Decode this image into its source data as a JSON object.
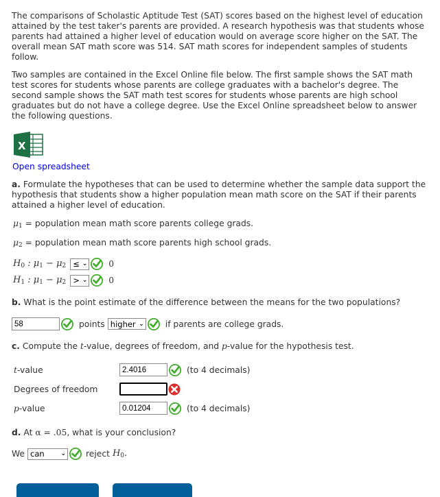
{
  "intro": {
    "paragraph1": "The comparisons of Scholastic Aptitude Test (SAT) scores based on the highest level of education attained by the test taker's parents are provided. A research hypothesis was that students whose parents had attained a higher level of education would on average score higher on the SAT. The overall mean SAT math score was 514. SAT math scores for independent samples of students follow.",
    "paragraph2": "Two samples are contained in the Excel Online file below. The first sample shows the SAT math test scores for students whose parents are college graduates with a bachelor's degree. The second sample shows the SAT math test scores for students whose parents are high school graduates but do not have a college degree. Use the Excel Online spreadsheet below to answer the following questions."
  },
  "spreadsheet": {
    "icon": "excel-icon",
    "link_label": "Open spreadsheet"
  },
  "part_a": {
    "label": "a.",
    "question": "Formulate the hypotheses that can be used to determine whether the sample data support the hypothesis that students show a higher population mean math score on the SAT if their parents attained a higher level of education.",
    "mu1_def": "= population mean math score parents college grads.",
    "mu2_def": "= population mean math score parents high school grads.",
    "h0": {
      "operator": "≤",
      "value": "0",
      "status": "correct"
    },
    "h1": {
      "operator": ">",
      "value": "0",
      "status": "correct"
    }
  },
  "part_b": {
    "label": "b.",
    "question": "What is the point estimate of the difference between the means for the two populations?",
    "value": "58",
    "value_status": "correct",
    "unit": "points",
    "direction": "higher",
    "direction_status": "correct",
    "suffix": "if parents are college grads."
  },
  "part_c": {
    "label": "c.",
    "question_pre": "Compute the ",
    "question_t": "t",
    "question_mid": "-value, degrees of freedom, and ",
    "question_p": "p",
    "question_post": "-value for the hypothesis test.",
    "rows": [
      {
        "label_math": "t",
        "label": "-value",
        "value": "2.4016",
        "status": "correct",
        "note": "(to 4 decimals)"
      },
      {
        "label_math": "",
        "label": "Degrees of freedom",
        "value": "",
        "status": "incorrect",
        "note": ""
      },
      {
        "label_math": "p",
        "label": "-value",
        "value": "0.01204",
        "status": "correct",
        "note": "(to 4 decimals)"
      }
    ]
  },
  "part_d": {
    "label": "d.",
    "question_pre": "At ",
    "alpha": "α = .05",
    "question_post": ", what is your conclusion?",
    "we": "We",
    "choice": "can",
    "choice_status": "correct",
    "reject": "reject",
    "h0": "H"
  },
  "colors": {
    "check_green": "#3fae29",
    "error_red": "#d9302c",
    "link": "#0000ee",
    "button": "#005f99"
  }
}
